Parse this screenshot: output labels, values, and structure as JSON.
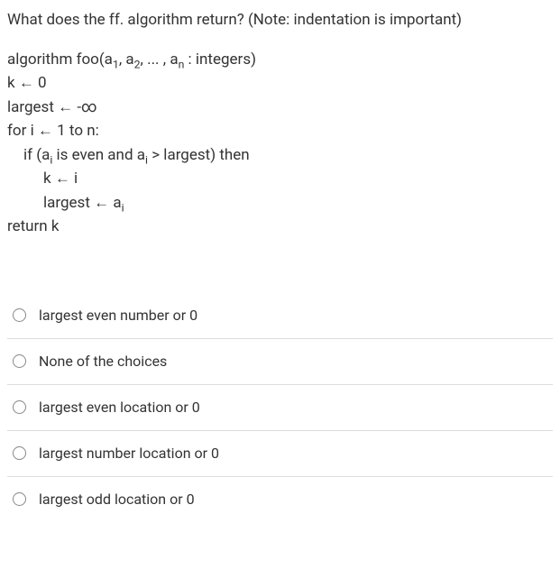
{
  "question": "What does the ff. algorithm return? (Note: indentation is important)",
  "algo": {
    "l1a": "algorithm foo(a",
    "l1b": "1",
    "l1c": ", a",
    "l1d": "2",
    "l1e": ", ... , a",
    "l1f": "n",
    "l1g": " : integers)",
    "l2": "k ← 0",
    "l3": "largest ← -∞",
    "l4": "for i ← 1 to n:",
    "l5a": "if (a",
    "l5b": "i",
    "l5c": " is even and a",
    "l5d": "i",
    "l5e": " > largest) then",
    "l6": "k ← i",
    "l7a": "largest ← a",
    "l7b": "i",
    "l8": "return k"
  },
  "choices": [
    "largest even number or 0",
    "None of the choices",
    "largest even location or 0",
    "largest number location or 0",
    "largest odd location or 0"
  ]
}
